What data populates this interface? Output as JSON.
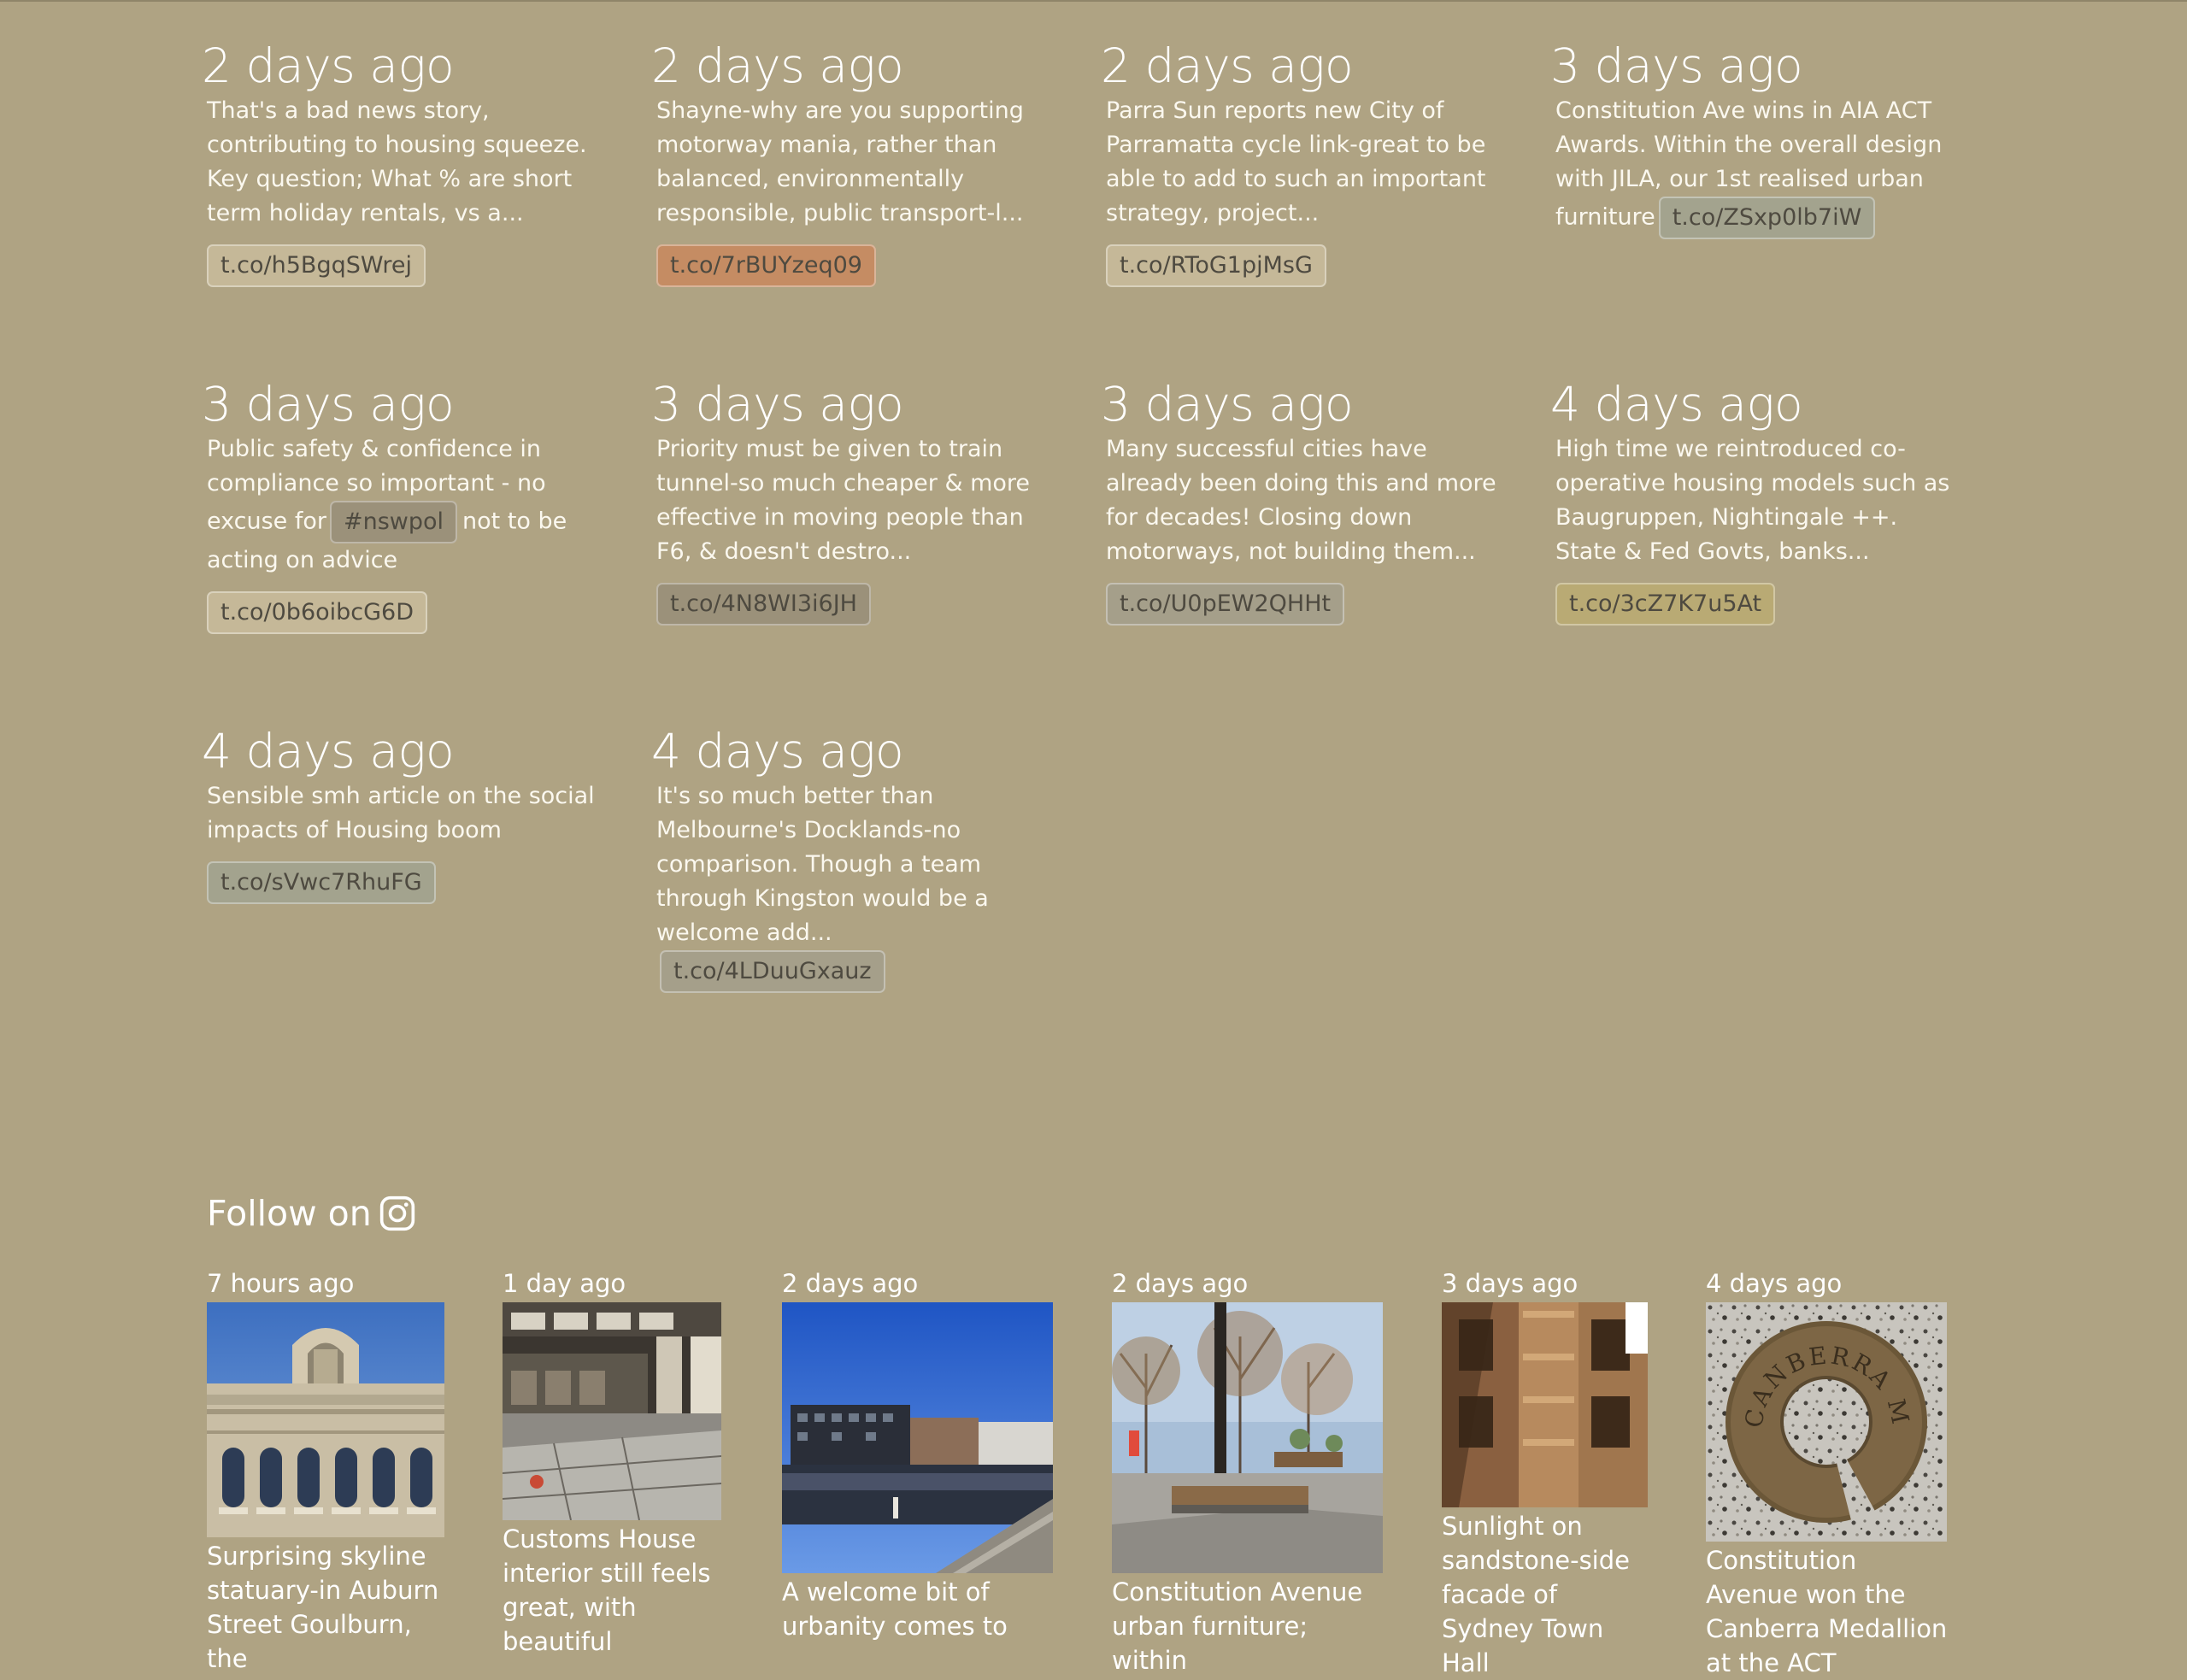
{
  "tweets": [
    {
      "age": "2 days ago",
      "text": "That's a bad news story, contributing to housing squeeze. Key question; What % are short term holiday rentals, vs a...",
      "link": "t.co/h5BgqSWrej"
    },
    {
      "age": "2 days ago",
      "text": "Shayne-why are you supporting motorway mania, rather than balanced, environmentally responsible, public transport-l...",
      "link": "t.co/7rBUYzeq09"
    },
    {
      "age": "2 days ago",
      "text": "Parra Sun reports new City of Parramatta cycle link-great to be able to add to such an important strategy, project...",
      "link": "t.co/RToG1pjMsG"
    },
    {
      "age": "3 days ago",
      "text": "Constitution Ave wins in AIA ACT Awards. Within the overall design with JILA, our 1st realised urban furniture",
      "link": "t.co/ZSxp0lb7iW"
    },
    {
      "age": "3 days ago",
      "text_before": "Public safety & confidence in compliance so important - no excuse for",
      "hashtag": "#nswpol",
      "text_after": "not to be acting on advice",
      "link": "t.co/0b6oibcG6D"
    },
    {
      "age": "3 days ago",
      "text": "Priority must be given to train tunnel-so much cheaper & more effective in moving people than F6, & doesn't destro...",
      "link": "t.co/4N8WI3i6JH"
    },
    {
      "age": "3 days ago",
      "text": "Many successful cities have already been doing this and more for decades! Closing down motorways, not building them...",
      "link": "t.co/U0pEW2QHHt"
    },
    {
      "age": "4 days ago",
      "text": "High time we reintroduced co-operative housing models such as Baugruppen, Nightingale ++. State & Fed Govts, banks...",
      "link": "t.co/3cZ7K7u5At"
    },
    {
      "age": "4 days ago",
      "text": "Sensible smh article on the social impacts of Housing boom",
      "link": "t.co/sVwc7RhuFG"
    },
    {
      "age": "4 days ago",
      "text": "It's so much better than Melbourne's Docklands-no comparison. Though a team through Kingston would be a welcome add...",
      "link": "t.co/4LDuuGxauz"
    }
  ],
  "colors": {
    "background": "#afa383",
    "pill_tan": "#c5b898",
    "pill_orange": "#c58c63",
    "pill_grey": "#a59f8a",
    "pill_green_grey": "#a3a38e",
    "pill_dark": "#9b917a",
    "pill_olive": "#b9aa74"
  },
  "instagram": {
    "follow_label": "Follow on",
    "icon": "instagram-icon",
    "posts": [
      {
        "age": "7 hours ago",
        "caption": "Surprising skyline statuary-in Auburn Street Goulburn, the",
        "image": "heritage-building-facade"
      },
      {
        "age": "1 day ago",
        "caption": "Customs House interior still feels great, with beautiful",
        "image": "customs-house-interior"
      },
      {
        "age": "2 days ago",
        "caption": "A welcome bit of urbanity comes to",
        "image": "waterfront-apartments"
      },
      {
        "age": "2 days ago",
        "caption": "Constitution Avenue urban furniture; within",
        "image": "street-benches-trees"
      },
      {
        "age": "3 days ago",
        "caption": "Sunlight on sandstone-side facade of Sydney Town Hall",
        "image": "sandstone-facade"
      },
      {
        "age": "4 days ago",
        "caption": "Constitution Avenue won the Canberra Medallion at the ACT",
        "image": "canberra-medallion",
        "medallion_text": "CANBERRA MEDALLION"
      }
    ]
  }
}
